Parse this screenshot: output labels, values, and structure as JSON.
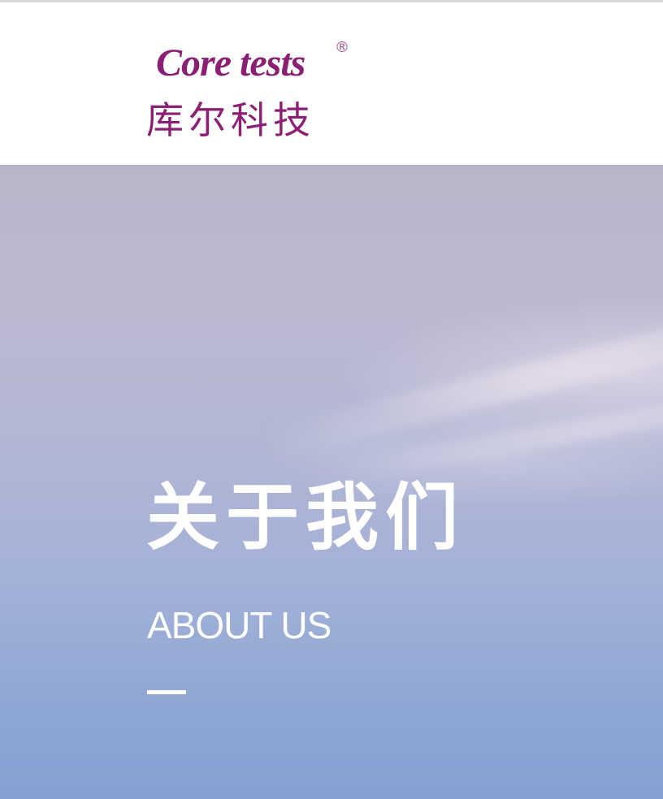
{
  "header": {
    "logo": {
      "text_en": "Core tests",
      "registered_mark": "®",
      "text_cn": "库尔科技"
    }
  },
  "banner": {
    "title": "关于我们",
    "subtitle": "ABOUT US"
  },
  "colors": {
    "brand": "#8b1f74",
    "banner_top": "#b9b5c9",
    "banner_bottom": "#86a0d2",
    "text_on_banner": "#ffffff"
  }
}
